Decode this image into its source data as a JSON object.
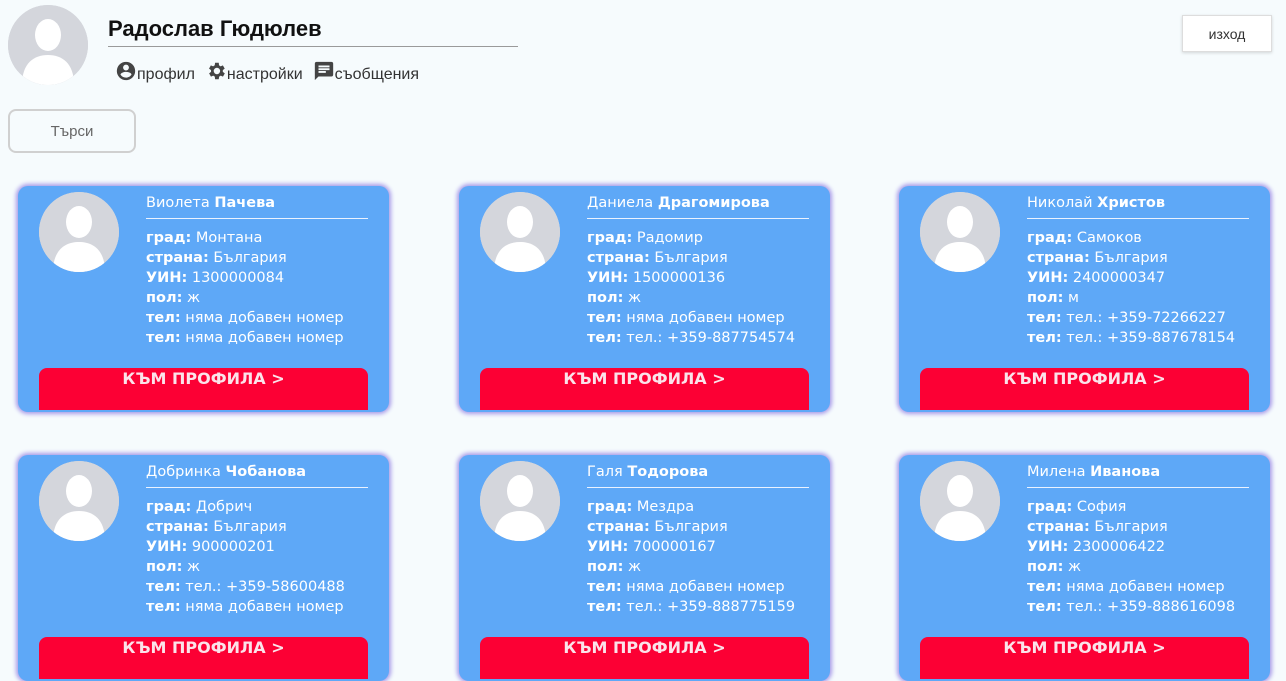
{
  "header": {
    "user_name": "Радослав Гюдюлев",
    "nav": [
      {
        "label": "профил",
        "icon": "account-circle-icon"
      },
      {
        "label": "настройки",
        "icon": "gear-icon"
      },
      {
        "label": "съобщения",
        "icon": "message-icon"
      }
    ],
    "logout_label": "изход"
  },
  "search_label": "Търси",
  "card_button_label": "КЪМ ПРОФИЛА >",
  "field_labels": {
    "city": "град:",
    "country": "страна:",
    "uin": "УИН:",
    "gender": "пол:",
    "phone1": "тел:",
    "phone2": "тел:"
  },
  "colors": {
    "card_bg": "#5ea8f7",
    "card_button": "#fc0034",
    "page_bg": "#f6fbfd"
  },
  "people": [
    {
      "first": "Виолета",
      "last": "Пачева",
      "city": "Монтана",
      "country": "България",
      "uin": "1300000084",
      "gender": "ж",
      "phone1": "няма добавен номер",
      "phone2": "няма добавен номер"
    },
    {
      "first": "Даниела",
      "last": "Драгомирова",
      "city": "Радомир",
      "country": "България",
      "uin": "1500000136",
      "gender": "ж",
      "phone1": "няма добавен номер",
      "phone2": "тел.: +359-887754574"
    },
    {
      "first": "Николай",
      "last": "Христов",
      "city": "Самоков",
      "country": "България",
      "uin": "2400000347",
      "gender": "м",
      "phone1": "тел.: +359-72266227",
      "phone2": "тел.: +359-887678154"
    },
    {
      "first": "Добринка",
      "last": "Чобанова",
      "city": "Добрич",
      "country": "България",
      "uin": "900000201",
      "gender": "ж",
      "phone1": "тел.: +359-58600488",
      "phone2": "няма добавен номер"
    },
    {
      "first": "Галя",
      "last": "Тодорова",
      "city": "Мездра",
      "country": "България",
      "uin": "700000167",
      "gender": "ж",
      "phone1": "няма добавен номер",
      "phone2": "тел.: +359-888775159"
    },
    {
      "first": "Милена",
      "last": "Иванова",
      "city": "София",
      "country": "България",
      "uin": "2300006422",
      "gender": "ж",
      "phone1": "няма добавен номер",
      "phone2": "тел.: +359-888616098"
    }
  ]
}
